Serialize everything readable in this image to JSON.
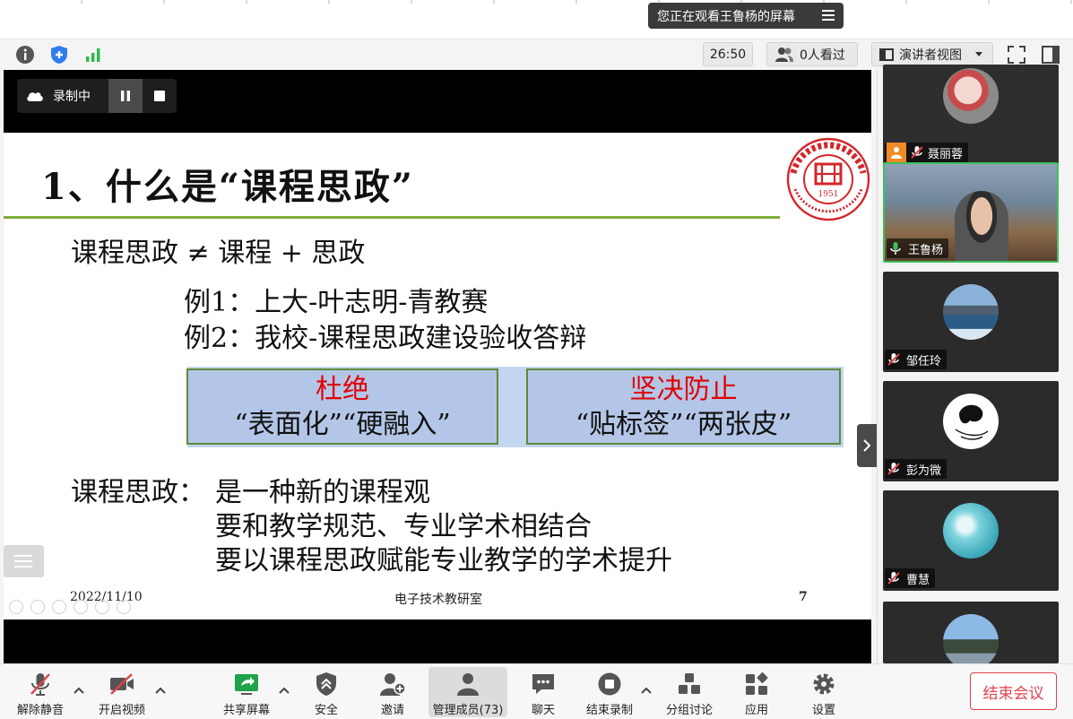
{
  "share_banner": {
    "text": "您正在观看王鲁杨的屏幕"
  },
  "info_bar": {
    "timer": "26:50",
    "viewers": "0人看过",
    "view_mode": "演讲者视图"
  },
  "recording": {
    "label": "录制中"
  },
  "slide": {
    "title": "1、什么是“课程思政”",
    "line1": "课程思政 ≠ 课程 + 思政",
    "example1": "例1：上大-叶志明-青教赛",
    "example2": "例2：我校-课程思政建设验收答辩",
    "box_left": {
      "heading": "杜绝",
      "text": "“表面化”“硬融入”"
    },
    "box_right": {
      "heading": "坚决防止",
      "text": "“贴标签”“两张皮”"
    },
    "point_label": "课程思政：",
    "point1": "是一种新的课程观",
    "point2": "要和教学规范、专业学术相结合",
    "point3": "要以课程思政赋能专业教学的学术提升",
    "footer_date": "2022/11/10",
    "footer_center": "电子技术教研室",
    "footer_page": "7",
    "logo_year": "1951"
  },
  "participants": [
    {
      "name": "聂丽蓉"
    },
    {
      "name": "王鲁杨"
    },
    {
      "name": "邹任玲"
    },
    {
      "name": "彭为微"
    },
    {
      "name": "曹慧"
    }
  ],
  "toolbar": {
    "unmute": "解除静音",
    "start_video": "开启视频",
    "share_screen": "共享屏幕",
    "security": "安全",
    "invite": "邀请",
    "participants": "管理成员(73)",
    "chat": "聊天",
    "end_recording": "结束录制",
    "breakout": "分组讨论",
    "apps": "应用",
    "settings": "设置",
    "end_meeting": "结束会议"
  },
  "colors": {
    "accent_green": "#3fbf5a",
    "danger_red": "#e2424c",
    "slide_rule": "#7fae3a",
    "callout_fill": "#b3c6e7"
  }
}
